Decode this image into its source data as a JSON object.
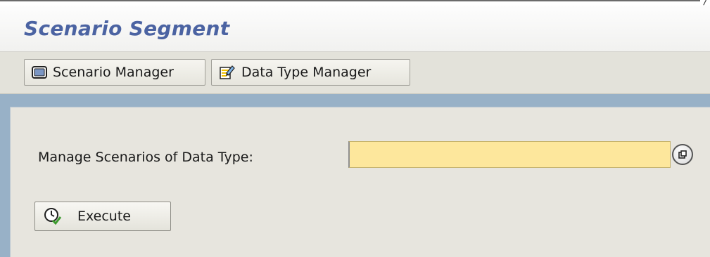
{
  "window": {
    "title": "Scenario Segment",
    "corner_mark": "/"
  },
  "toolbar": {
    "scenario_manager_label": "Scenario Manager",
    "scenario_manager_icon": "monitor-icon",
    "data_type_manager_label": "Data Type Manager",
    "data_type_manager_icon": "edit-document-icon"
  },
  "form": {
    "data_type_label": "Manage Scenarios of Data Type:",
    "data_type_value": "",
    "value_help_icon": "value-help-icon",
    "execute_label": "Execute",
    "execute_icon": "execute-clock-icon"
  },
  "colors": {
    "title": "#4b63a2",
    "toolbar_bg": "#e3e2da",
    "strip_bg": "#98b1c7",
    "panel_bg": "#e7e5de",
    "input_bg": "#fde79c"
  }
}
